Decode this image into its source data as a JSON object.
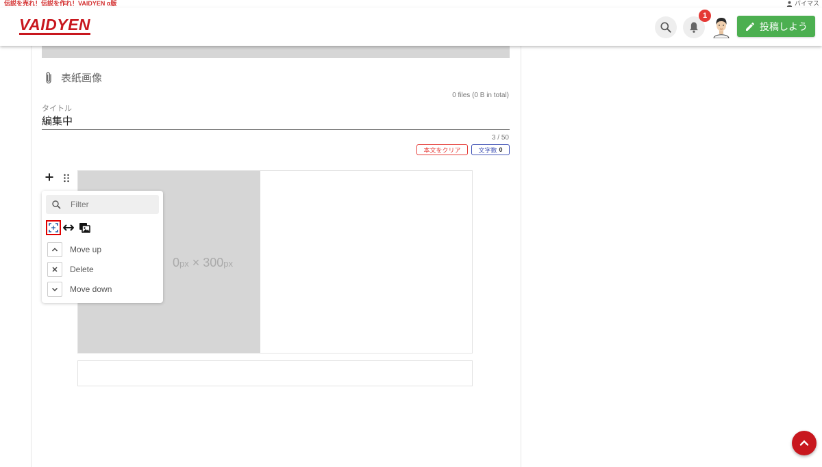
{
  "top_strip": {
    "tagline": "伝説を売れ！伝説を作れ！VAIDYEN α版",
    "user_name": "バイマス"
  },
  "header": {
    "logo": "VAIDYEN",
    "notification_count": "1",
    "post_button_label": "投稿しよう"
  },
  "editor": {
    "cover_image_label": "表紙画像",
    "files_info": "0 files (0 B in total)",
    "title_label": "タイトル",
    "title_value": "編集中",
    "char_counter": "3 / 50",
    "clear_button_label": "本文をクリア",
    "char_count_label": "文字数",
    "char_count_value": "0"
  },
  "image_block": {
    "placeholder_prefix": "0",
    "placeholder_unit1": "px",
    "placeholder_times": " × 300",
    "placeholder_unit2": "px"
  },
  "block_menu": {
    "filter_placeholder": "Filter",
    "items": [
      {
        "label": "Move up",
        "icon": "chevron-up-icon"
      },
      {
        "label": "Delete",
        "icon": "close-icon"
      },
      {
        "label": "Move down",
        "icon": "chevron-down-icon"
      }
    ]
  },
  "colors": {
    "brand_red": "#c8171e",
    "post_green": "#4caf50",
    "badge_red": "#e53935",
    "count_blue": "#3f51b5"
  }
}
